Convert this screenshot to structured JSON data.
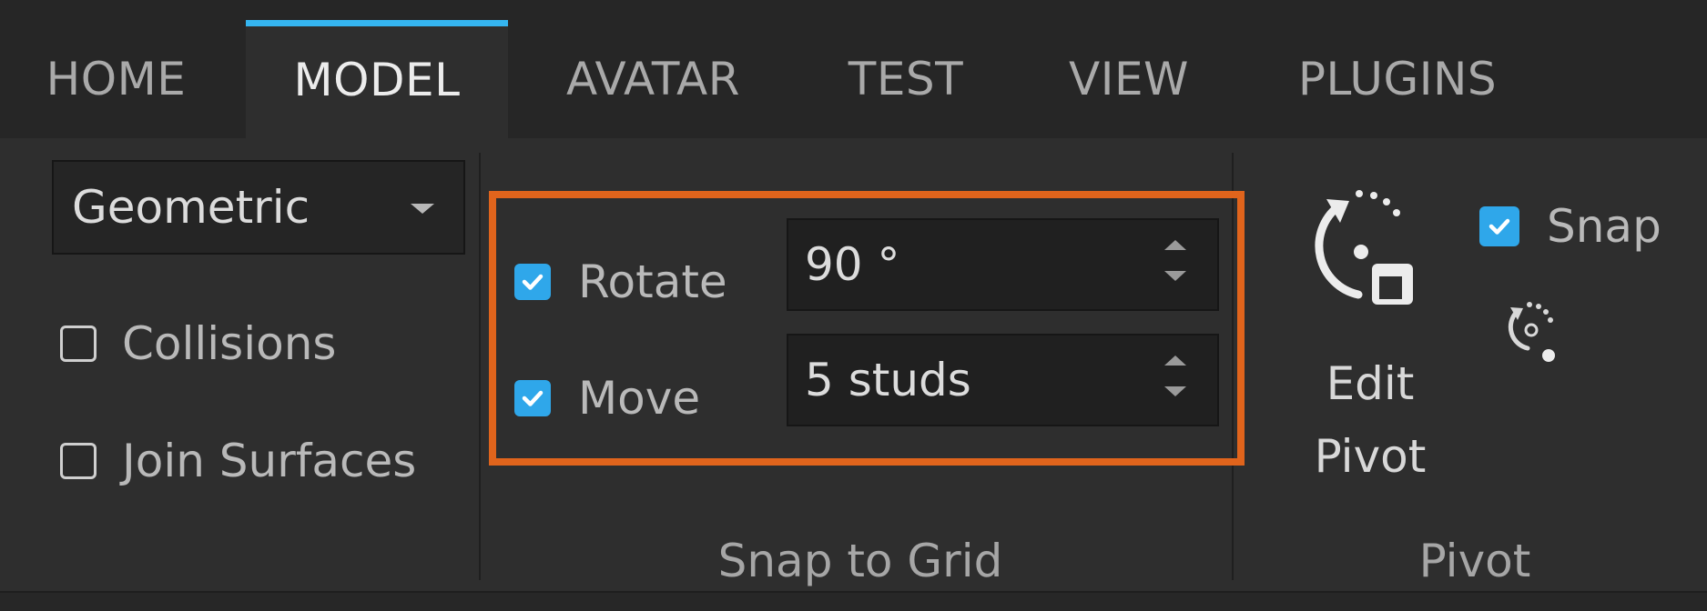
{
  "tabs": [
    {
      "label": "HOME",
      "active": false
    },
    {
      "label": "MODEL",
      "active": true
    },
    {
      "label": "AVATAR",
      "active": false
    },
    {
      "label": "TEST",
      "active": false
    },
    {
      "label": "VIEW",
      "active": false
    },
    {
      "label": "PLUGINS",
      "active": false
    }
  ],
  "colors": {
    "accent": "#35b5f0",
    "checkbox_on": "#2fa7ea",
    "highlight": "#e0641c",
    "background": "#2e2e2e"
  },
  "tools": {
    "transform_mode": "Geometric",
    "collisions": {
      "label": "Collisions",
      "checked": false
    },
    "join_surfaces": {
      "label": "Join Surfaces",
      "checked": false
    }
  },
  "snap_to_grid": {
    "title": "Snap to Grid",
    "rotate": {
      "label": "Rotate",
      "checked": true,
      "value": "90 °"
    },
    "move": {
      "label": "Move",
      "checked": true,
      "value": "5 studs"
    }
  },
  "pivot": {
    "title": "Pivot",
    "edit_pivot_line1": "Edit",
    "edit_pivot_line2": "Pivot",
    "snap": {
      "label": "Snap",
      "checked": true
    },
    "icons": [
      "edit-pivot-icon",
      "pivot-reset-icon"
    ]
  }
}
